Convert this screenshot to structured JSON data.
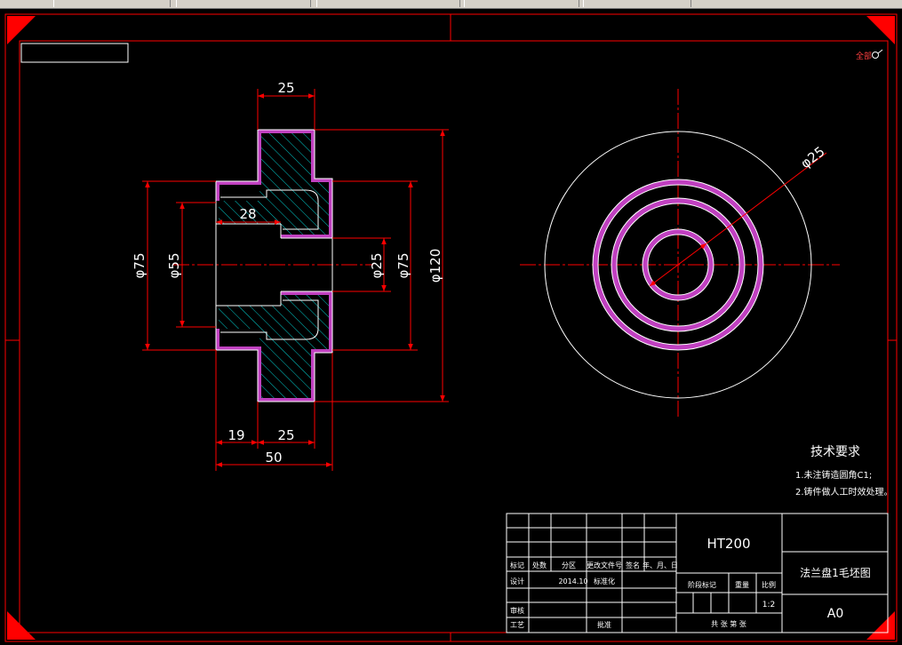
{
  "dimensions": {
    "d25_top": "25",
    "d28": "28",
    "d19": "19",
    "d25_bottom": "25",
    "d50": "50",
    "phi75_left": "φ75",
    "phi55": "φ55",
    "phi25_mid": "φ25",
    "phi75_right": "φ75",
    "phi120": "φ120",
    "phi25_circle": "φ25"
  },
  "corner_mark": "全部",
  "tech_requirements": {
    "title": "技术要求",
    "item1": "1.未注铸造圆角C1;",
    "item2": "2.铸件做人工时效处理。"
  },
  "title_block": {
    "material": "HT200",
    "drawing_name": "法兰盘1毛坯图",
    "sheet_size": "A0",
    "scale_label": "比例",
    "scale_value": "1:2",
    "stage_mark_label": "阶段标记",
    "weight_label": "重量",
    "sheets_label": "共   张   第   张",
    "row_headers": [
      "标记",
      "处数",
      "分区",
      "更改文件号",
      "签名",
      "年、月、日"
    ],
    "design_label": "设计",
    "design_date": "2014.10",
    "standardize_label": "标准化",
    "review_label": "审核",
    "process_label": "工艺",
    "approve_label": "批准"
  },
  "colors": {
    "background": "#000000",
    "border": "#ff0000",
    "outline": "#ffffff",
    "hatch": "#00c8c8",
    "fillet": "#c040c0",
    "dimension": "#ff0000"
  }
}
